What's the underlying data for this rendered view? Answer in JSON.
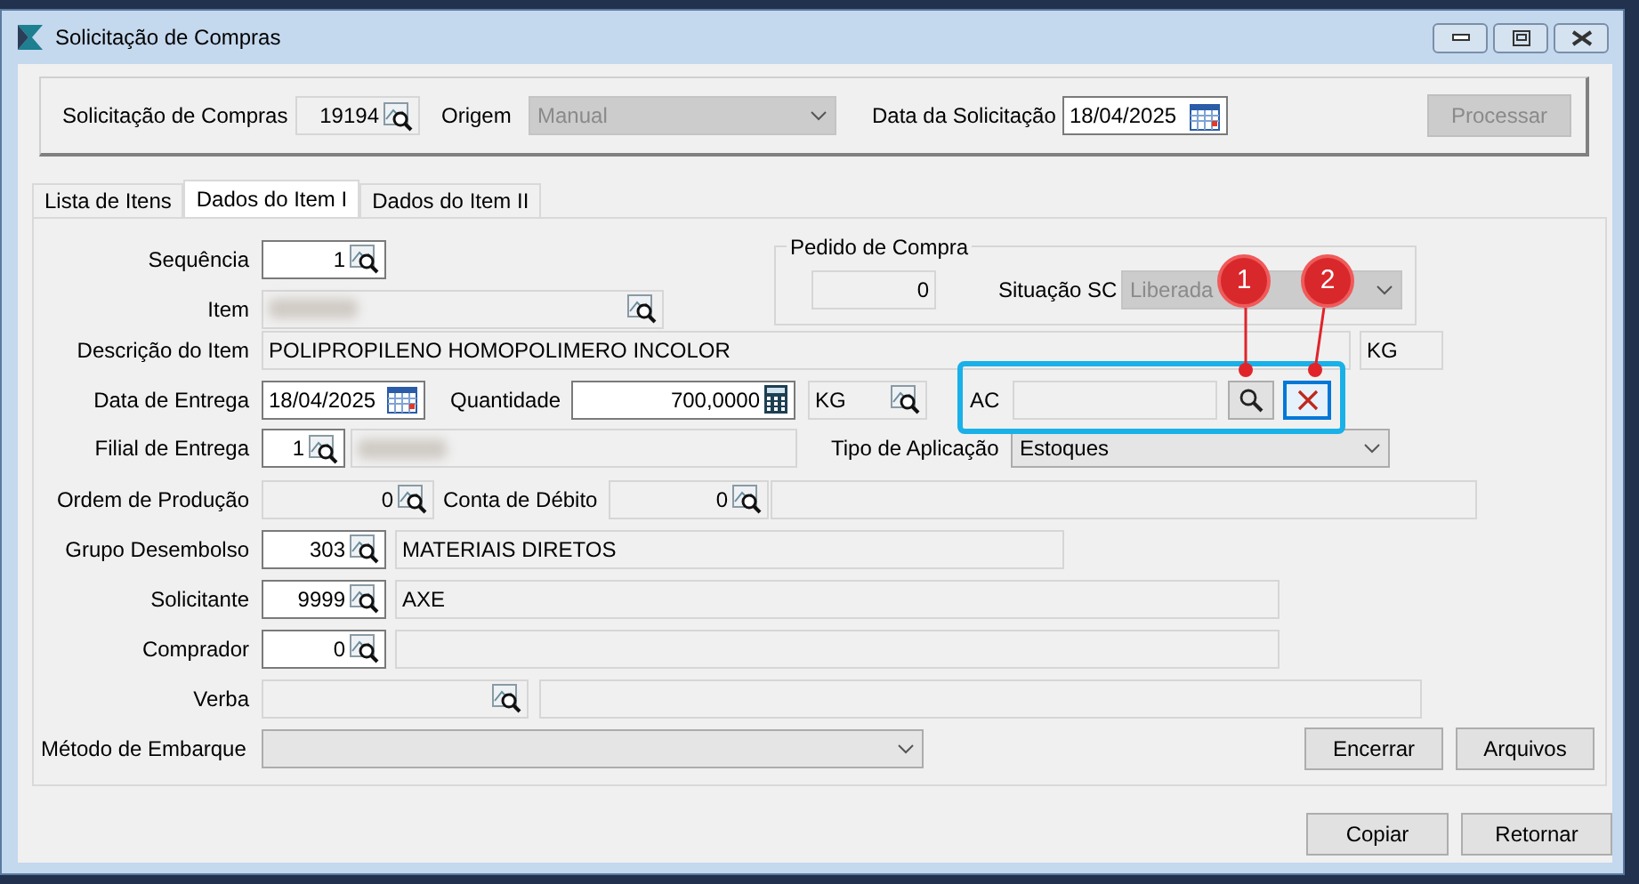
{
  "window": {
    "title": "Solicitação de Compras"
  },
  "header": {
    "request": {
      "label": "Solicitação de Compras",
      "value": "19194",
      "readonly": true
    },
    "origin": {
      "label": "Origem",
      "value": "Manual",
      "disabled": true
    },
    "request_date": {
      "label": "Data da Solicitação",
      "value": "18/04/2025",
      "readonly": false
    },
    "process_button": {
      "label": "Processar",
      "disabled": true
    }
  },
  "tabs": [
    {
      "label": "Lista de Itens",
      "selected": false
    },
    {
      "label": "Dados do Item I",
      "selected": true
    },
    {
      "label": "Dados do Item II",
      "selected": false
    }
  ],
  "purchase_order": {
    "title": "Pedido de Compra",
    "number": {
      "value": "0",
      "readonly": true
    },
    "status": {
      "label": "Situação SC",
      "value": "Liberada",
      "disabled": true
    }
  },
  "form": {
    "sequence": {
      "label": "Sequência",
      "value": "1",
      "readonly": false
    },
    "item": {
      "label": "Item",
      "readonly": true
    },
    "description": {
      "label": "Descrição do Item",
      "value": "POLIPROPILENO HOMOPOLIMERO INCOLOR",
      "readonly": true
    },
    "description_unit": {
      "value": "KG",
      "readonly": true
    },
    "delivery_date": {
      "label": "Data de Entrega",
      "value": "18/04/2025",
      "readonly": false
    },
    "quantity": {
      "label": "Quantidade",
      "value": "700,0000",
      "readonly": false
    },
    "unit": {
      "value": "KG",
      "readonly": true
    },
    "ac": {
      "label": "AC",
      "readonly": true
    },
    "delivery_branch": {
      "label": "Filial de Entrega",
      "value": "1",
      "readonly": false
    },
    "delivery_branch_name": {
      "readonly": true
    },
    "application_type": {
      "label": "Tipo de Aplicação",
      "value": "Estoques",
      "disabled": false
    },
    "production_order": {
      "label": "Ordem de Produção",
      "value": "0",
      "readonly": true
    },
    "debit_account": {
      "label": "Conta de Débito",
      "value": "0",
      "readonly": true
    },
    "debit_account_name": {
      "readonly": true
    },
    "disbursement_group": {
      "label": "Grupo Desembolso",
      "value": "303",
      "readonly": false
    },
    "disbursement_group_name": {
      "value": "MATERIAIS DIRETOS",
      "readonly": true
    },
    "requester": {
      "label": "Solicitante",
      "value": "9999",
      "readonly": false
    },
    "requester_name": {
      "value": "AXE",
      "readonly": true
    },
    "buyer": {
      "label": "Comprador",
      "value": "0",
      "readonly": false
    },
    "buyer_name": {
      "readonly": true
    },
    "budget": {
      "label": "Verba",
      "readonly": true
    },
    "budget_name": {
      "readonly": true
    },
    "shipping_method": {
      "label": "Método de Embarque",
      "disabled": false
    }
  },
  "panel_buttons": [
    {
      "label": "Encerrar"
    },
    {
      "label": "Arquivos"
    }
  ],
  "footer_buttons": [
    {
      "label": "Copiar"
    },
    {
      "label": "Retornar"
    }
  ],
  "annotations": [
    {
      "label": "1"
    },
    {
      "label": "2"
    }
  ]
}
